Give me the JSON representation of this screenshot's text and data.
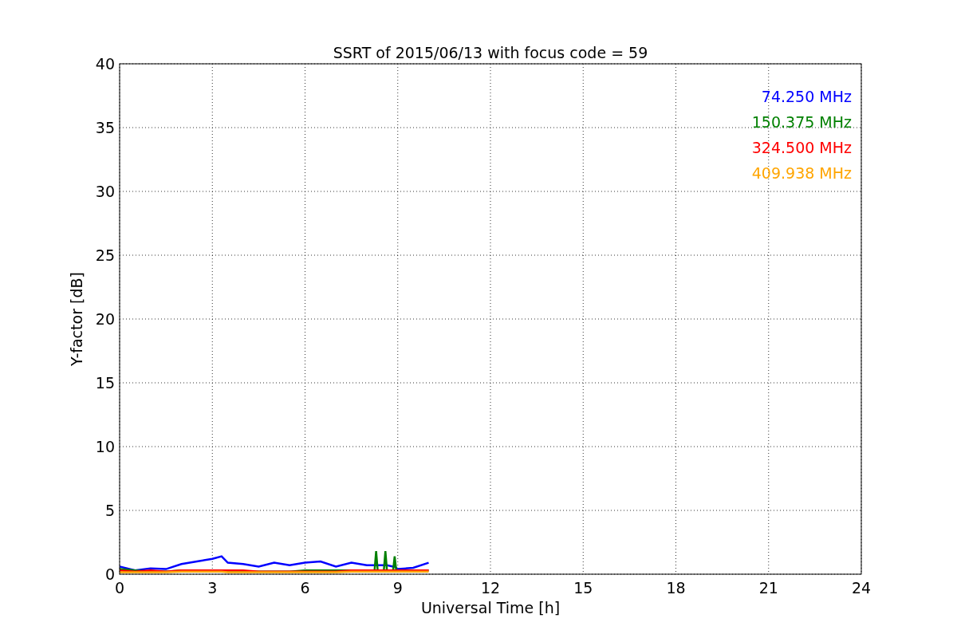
{
  "figure": {
    "chart_data": {
      "type": "line",
      "title": "SSRT of 2015/06/13 with focus code = 59",
      "xlabel": "Universal Time [h]",
      "ylabel": "Y-factor [dB]",
      "x": [
        0,
        0.5,
        1,
        1.5,
        2,
        2.5,
        3,
        3.3,
        3.5,
        4,
        4.5,
        5,
        5.5,
        6,
        6.5,
        7,
        7.5,
        8,
        8.25,
        8.3,
        8.35,
        8.55,
        8.6,
        8.65,
        8.85,
        8.9,
        8.95,
        9,
        9.5,
        10
      ],
      "series": [
        {
          "name": "74.250 MHz",
          "color": "#0000ff",
          "values": [
            0.6,
            0.3,
            0.45,
            0.4,
            0.8,
            1.0,
            1.2,
            1.4,
            0.9,
            0.8,
            0.6,
            0.9,
            0.7,
            0.9,
            1.0,
            0.6,
            0.9,
            0.7,
            0.7,
            0.7,
            0.7,
            0.7,
            0.7,
            0.7,
            0.6,
            0.6,
            0.5,
            0.4,
            0.5,
            0.9
          ]
        },
        {
          "name": "150.375 MHz",
          "color": "#008000",
          "values": [
            0.4,
            0.3,
            0.2,
            0.2,
            0.3,
            0.3,
            0.3,
            0.3,
            0.2,
            0.2,
            0.2,
            0.2,
            0.2,
            0.3,
            0.3,
            0.3,
            0.3,
            0.3,
            0.3,
            1.8,
            0.3,
            0.3,
            1.8,
            0.3,
            0.3,
            1.4,
            0.3,
            0.3,
            0.3,
            0.3
          ]
        },
        {
          "name": "324.500 MHz",
          "color": "#ff0000",
          "values": [
            0.3,
            0.2,
            0.3,
            0.2,
            0.3,
            0.3,
            0.3,
            0.3,
            0.3,
            0.3,
            0.2,
            0.2,
            0.2,
            0.2,
            0.2,
            0.2,
            0.3,
            0.3,
            0.3,
            0.3,
            0.3,
            0.3,
            0.3,
            0.3,
            0.3,
            0.3,
            0.3,
            0.3,
            0.3,
            0.3
          ]
        },
        {
          "name": "409.938 MHz",
          "color": "#ffa500",
          "values": [
            0.15,
            0.15,
            0.15,
            0.15,
            0.2,
            0.2,
            0.2,
            0.2,
            0.15,
            0.15,
            0.15,
            0.15,
            0.15,
            0.15,
            0.15,
            0.15,
            0.2,
            0.2,
            0.2,
            0.2,
            0.2,
            0.2,
            0.2,
            0.2,
            0.2,
            0.2,
            0.2,
            0.2,
            0.2,
            0.2
          ]
        }
      ],
      "grid": true,
      "xlim": [
        0,
        24
      ],
      "ylim": [
        0,
        40
      ],
      "xticks": [
        0,
        3,
        6,
        9,
        12,
        15,
        18,
        21,
        24
      ],
      "yticks": [
        0,
        5,
        10,
        15,
        20,
        25,
        30,
        35,
        40
      ]
    }
  }
}
